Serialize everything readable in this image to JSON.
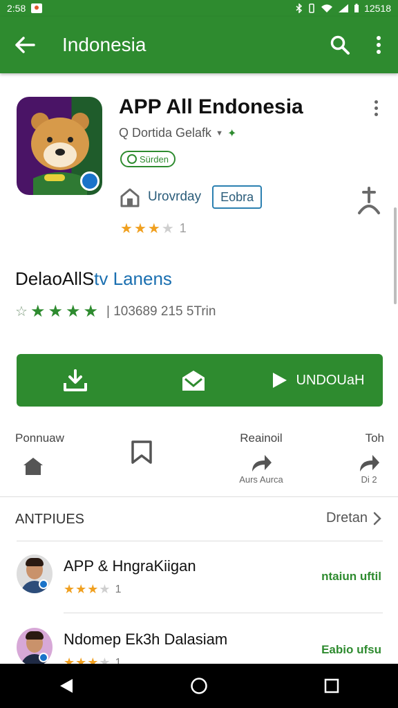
{
  "status_bar": {
    "time": "2:58",
    "clock_right": "12518"
  },
  "app_bar": {
    "title": "Indonesia"
  },
  "app": {
    "title": "APP All Endonesia",
    "developer": "Q Dortida Gelafk",
    "badge": "Sürden",
    "home_label": "Urovrday",
    "outline_button": "Eobra",
    "rating_count": "1",
    "rating_stars": 3.5
  },
  "section": {
    "title_main": "DelaoAllS",
    "title_accent": "tv Lanens",
    "stats": "| 103689 215 5Trin",
    "stars": 4
  },
  "actions": {
    "play_label": "UNDOUaH"
  },
  "shortcuts": [
    {
      "label": "Ponnuaw",
      "sub": ""
    },
    {
      "label": "",
      "sub": ""
    },
    {
      "label": "Reainoil",
      "sub": "Aurs Aurca"
    },
    {
      "label": "Toh",
      "sub": "Di 2"
    }
  ],
  "list": {
    "header": "ANTPIUES",
    "more": "Dretan",
    "items": [
      {
        "name": "APP & HngraKiigan",
        "rating_count": "1",
        "action": "ntaiun uftil"
      },
      {
        "name": "Ndomep Ek3h Dalasiam",
        "rating_count": "1",
        "action": "Eabio ufsu"
      }
    ]
  },
  "colors": {
    "primary": "#2e8b2f",
    "accent_blue": "#1a73c9",
    "star": "#f0a020"
  }
}
